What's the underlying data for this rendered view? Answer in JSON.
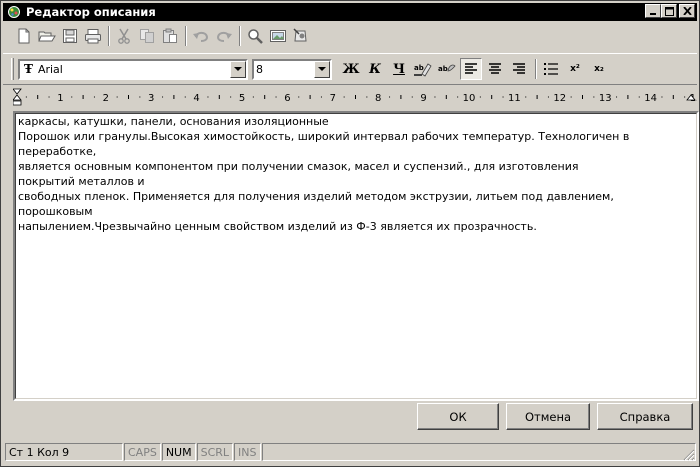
{
  "window": {
    "title": "Редактор описания",
    "controls": {
      "minimize": "_",
      "maximize": "□",
      "close": "×"
    }
  },
  "toolbar": {
    "items": [
      "new-document",
      "open",
      "save",
      "print",
      "cut",
      "copy",
      "paste",
      "undo",
      "redo",
      "find",
      "insert-image",
      "insert-object"
    ]
  },
  "format_toolbar": {
    "font_family": "Arial",
    "font_family_icon": "Ŧ",
    "font_size": "8",
    "bold_label": "Ж",
    "italic_label": "К",
    "underline_label": "Ч",
    "alignment": "left",
    "superscript_label": "x²",
    "subscript_label": "x₂"
  },
  "ruler": {
    "labels": [
      "1",
      "2",
      "3",
      "4",
      "5",
      "6",
      "7",
      "8",
      "9",
      "10",
      "11",
      "12",
      "13",
      "14",
      "15"
    ]
  },
  "editor": {
    "lines": [
      "каркасы, катушки, панели, основания изоляционные",
      "Порошок или гранулы.Высокая химостойкость, широкий интервал рабочих температур. Технологичен в",
      "переработке,",
      "является основным компонентом при получении смазок, масел и суспензий., для изготовления",
      "покрытий металлов и",
      "свободных пленок. Применяется для получения изделий методом экструзии, литьем под давлением,",
      "порошковым",
      "напылением.Чрезвычайно ценным свойством изделий из Ф-3  является их прозрачность."
    ]
  },
  "buttons": {
    "ok": "ОК",
    "cancel": "Отмена",
    "help": "Справка"
  },
  "statusbar": {
    "position": "Ст 1 Кол 9",
    "caps": "CAPS",
    "num": "NUM",
    "scrl": "SCRL",
    "ins": "INS"
  }
}
